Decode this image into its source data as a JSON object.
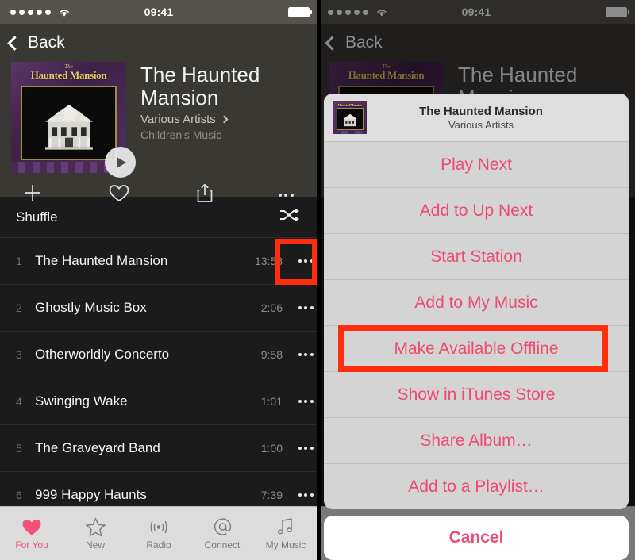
{
  "status_bar": {
    "signal_dots": 5,
    "wifi_icon": "wifi-icon",
    "time": "09:41",
    "battery_icon": "battery-full-icon"
  },
  "nav": {
    "back_label": "Back",
    "back_icon": "chevron-left-icon"
  },
  "album": {
    "art_title": "Haunted Mansion",
    "art_the": "The",
    "title": "The Haunted Mansion",
    "artist": "Various Artists",
    "artist_chevron": "chevron-right-icon",
    "genre": "Children's Music",
    "play_icon": "play-icon"
  },
  "actions": [
    {
      "name": "add-button",
      "icon": "plus-icon"
    },
    {
      "name": "love-button",
      "icon": "heart-outline-icon"
    },
    {
      "name": "share-button",
      "icon": "share-icon"
    },
    {
      "name": "more-button",
      "icon": "ellipsis-icon"
    }
  ],
  "shuffle": {
    "label": "Shuffle",
    "icon": "shuffle-icon"
  },
  "tracks": [
    {
      "num": "1",
      "title": "The Haunted Mansion",
      "time": "13:58"
    },
    {
      "num": "2",
      "title": "Ghostly Music Box",
      "time": "2:06"
    },
    {
      "num": "3",
      "title": "Otherworldly Concerto",
      "time": "9:58"
    },
    {
      "num": "4",
      "title": "Swinging Wake",
      "time": "1:01"
    },
    {
      "num": "5",
      "title": "The Graveyard Band",
      "time": "1:00"
    },
    {
      "num": "6",
      "title": "999 Happy Haunts",
      "time": "7:39"
    }
  ],
  "tabs": [
    {
      "label": "For You",
      "icon": "heart-filled-icon",
      "active": true
    },
    {
      "label": "New",
      "icon": "star-outline-icon",
      "active": false
    },
    {
      "label": "Radio",
      "icon": "radio-waves-icon",
      "active": false
    },
    {
      "label": "Connect",
      "icon": "at-sign-icon",
      "active": false
    },
    {
      "label": "My Music",
      "icon": "music-notes-icon",
      "active": false
    }
  ],
  "action_sheet": {
    "header_title": "The Haunted Mansion",
    "header_subtitle": "Various Artists",
    "items": [
      "Play Next",
      "Add to Up Next",
      "Start Station",
      "Add to My Music",
      "Make Available Offline",
      "Show in iTunes Store",
      "Share Album…",
      "Add to a Playlist…"
    ],
    "cancel_label": "Cancel"
  },
  "highlights": {
    "color": "#ff2d0c",
    "track_more_button": "track-1-more-button",
    "make_available_offline": "make-available-offline-item"
  }
}
